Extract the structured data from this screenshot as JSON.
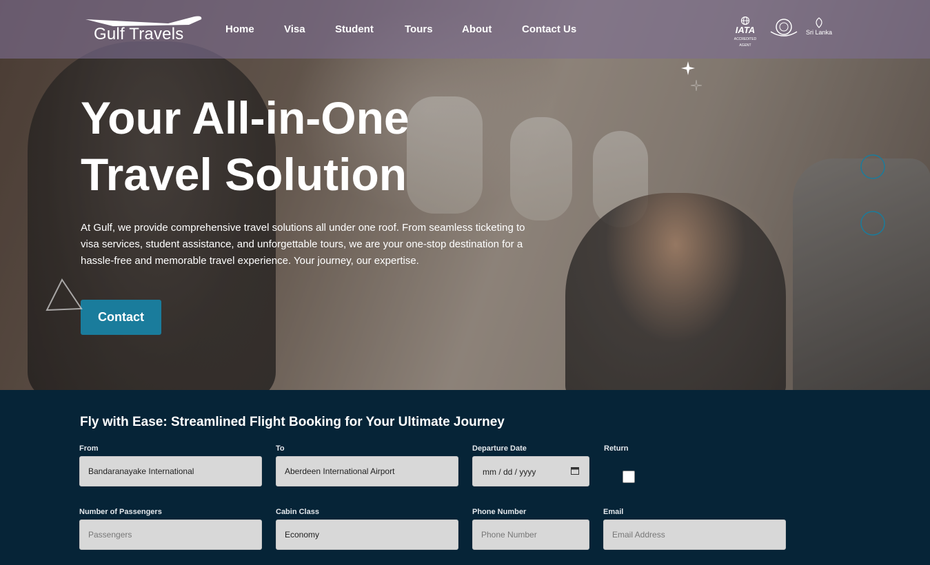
{
  "brand": {
    "logo_text": "Gulf Travels"
  },
  "nav": {
    "items": [
      "Home",
      "Visa",
      "Student",
      "Tours",
      "About",
      "Contact Us"
    ]
  },
  "accreditations": [
    {
      "main": "IATA",
      "sub": "ACCREDITED AGENT"
    },
    {
      "main": "",
      "sub": ""
    },
    {
      "main": "Sri Lanka",
      "sub": ""
    }
  ],
  "hero": {
    "title_line1": "Your All-in-One",
    "title_line2": "Travel Solution",
    "description": "At Gulf, we provide comprehensive travel solutions all under one roof. From seamless ticketing to visa services, student assistance, and unforgettable tours, we are your one-stop destination for a hassle-free and memorable travel experience. Your journey, our expertise.",
    "cta_label": "Contact"
  },
  "booking": {
    "title": "Fly with Ease: Streamlined Flight Booking for Your Ultimate Journey",
    "from": {
      "label": "From",
      "value": "Bandaranayake International"
    },
    "to": {
      "label": "To",
      "value": "Aberdeen International Airport"
    },
    "departure": {
      "label": "Departure Date",
      "value": "mm / dd / yyyy"
    },
    "return": {
      "label": "Return",
      "checked": false
    },
    "passengers": {
      "label": "Number of Passengers",
      "placeholder": "Passengers"
    },
    "cabin": {
      "label": "Cabin Class",
      "value": "Economy"
    },
    "phone": {
      "label": "Phone Number",
      "placeholder": "Phone Number"
    },
    "email": {
      "label": "Email",
      "placeholder": "Email Address"
    }
  },
  "colors": {
    "accent": "#1a7c9c",
    "booking_bg": "#062437",
    "header_bg": "#7d6e91",
    "field_bg": "#d8d8d8"
  }
}
